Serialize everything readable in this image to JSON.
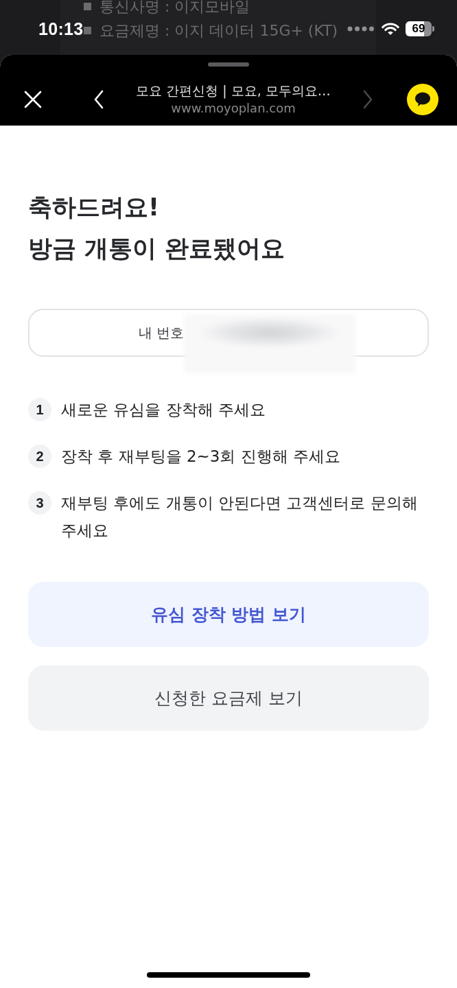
{
  "status_bar": {
    "time": "10:13",
    "battery": "69"
  },
  "background_page": {
    "lines": [
      "통신사명 : 이지모바일",
      "요금제명 : 이지 데이터 15G+ (KT)"
    ]
  },
  "browser_header": {
    "title": "모요 간편신청 | 모요, 모두의요…",
    "url": "www.moyoplan.com",
    "nav_buttons": [
      {
        "kind": "back",
        "disabled": false
      },
      {
        "kind": "forward",
        "disabled": true
      }
    ]
  },
  "title_lines": [
    "축하드려요!",
    "방금 개통이 완료됐어요"
  ],
  "my_number": {
    "label": "내 번호",
    "redacted": true
  },
  "steps": [
    {
      "number": "1",
      "text": "새로운 유심을 장착해 주세요"
    },
    {
      "number": "2",
      "text": "장착 후 재부팅을 2~3회 진행해 주세요"
    },
    {
      "number": "3",
      "text": "재부팅 후에도 개통이 안된다면 고객센터로 문의해 주세요"
    }
  ],
  "buttons": [
    {
      "label": "유심 장착 방법 보기",
      "kind": "primary"
    },
    {
      "label": "신청한 요금제 보기",
      "kind": "secondary"
    }
  ]
}
